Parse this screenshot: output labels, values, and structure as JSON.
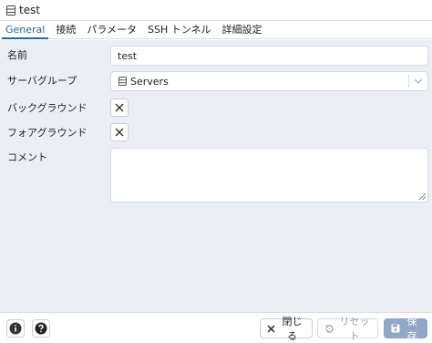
{
  "window": {
    "title": "test"
  },
  "tabs": [
    {
      "label": "General",
      "active": true
    },
    {
      "label": "接続"
    },
    {
      "label": "パラメータ"
    },
    {
      "label": "SSH トンネル"
    },
    {
      "label": "詳細設定"
    }
  ],
  "form": {
    "name_label": "名前",
    "name_value": "test",
    "group_label": "サーバグループ",
    "group_value": "Servers",
    "bg_label": "バックグラウンド",
    "fg_label": "フォアグラウンド",
    "comment_label": "コメント",
    "comment_value": ""
  },
  "footer": {
    "close_label": "閉じる",
    "reset_label": "リセット",
    "save_label": "保存"
  },
  "colors": {
    "accent": "#326690",
    "content_bg": "#ebeef3",
    "save_bg": "#8fa8c8"
  }
}
